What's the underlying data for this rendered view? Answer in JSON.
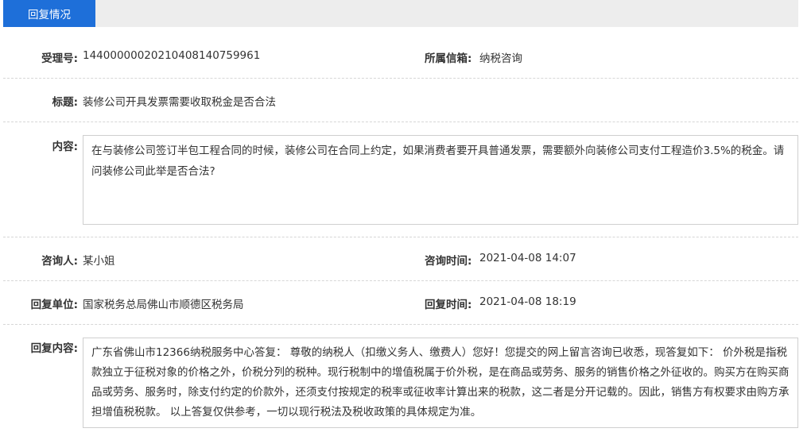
{
  "tab": {
    "label": "回复情况"
  },
  "fields": {
    "accept_no": {
      "label": "受理号:",
      "value": "14400000020210408140759961"
    },
    "mailbox": {
      "label": "所属信箱:",
      "value": "纳税咨询"
    },
    "title": {
      "label": "标题:",
      "value": "装修公司开具发票需要收取税金是否合法"
    },
    "content": {
      "label": "内容:",
      "value": "在与装修公司签订半包工程合同的时候，装修公司在合同上约定，如果消费者要开具普通发票，需要额外向装修公司支付工程造价3.5%的税金。请问装修公司此举是否合法?"
    },
    "asker": {
      "label": "咨询人:",
      "value": "某小姐"
    },
    "ask_time": {
      "label": "咨询时间:",
      "value": "2021-04-08 14:07"
    },
    "reply_unit": {
      "label": "回复单位:",
      "value": "国家税务总局佛山市顺德区税务局"
    },
    "reply_time": {
      "label": "回复时间:",
      "value": "2021-04-08 18:19"
    },
    "reply_content": {
      "label": "回复内容:",
      "value": "广东省佛山市12366纳税服务中心答复： 尊敬的纳税人（扣缴义务人、缴费人）您好！您提交的网上留言咨询已收悉，现答复如下： 价外税是指税款独立于征税对象的价格之外，价税分列的税种。现行税制中的增值税属于价外税，是在商品或劳务、服务的销售价格之外征收的。购买方在购买商品或劳务、服务时，除支付约定的价款外，还须支付按规定的税率或征收率计算出来的税款，这二者是分开记载的。因此，销售方有权要求由购方承担增值税税款。 以上答复仅供参考，一切以现行税法及税收政策的具体规定为准。"
    }
  }
}
